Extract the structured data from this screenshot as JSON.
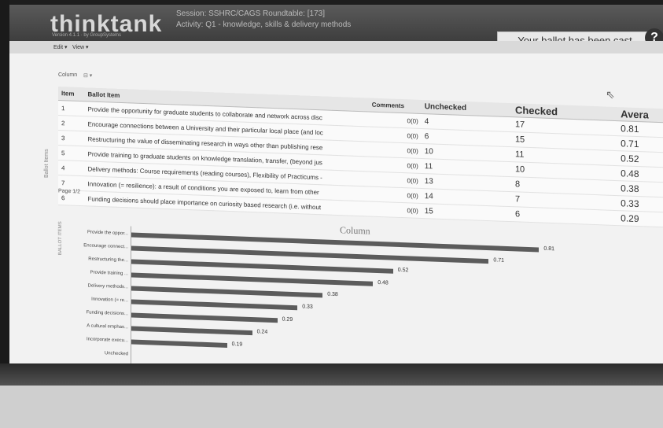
{
  "app": {
    "logo": "thinktank",
    "logo_sub": "Version 4.1.1 · by GroupSystems",
    "session": "Session: SSHRC/CAGS Roundtable: [173]",
    "activity": "Activity: Q1 - knowledge, skills & delivery methods",
    "ballot_status": "Your ballot has been cast",
    "help_icon": "?"
  },
  "menubar": {
    "edit": "Edit ▾",
    "view": "View ▾"
  },
  "column_selector": {
    "label": "Column",
    "icon": "⊟ ▾"
  },
  "side_tab": "Ballot Items",
  "table": {
    "headers": {
      "item": "Item",
      "ballot": "Ballot Item",
      "comments": "Comments",
      "unchecked": "Unchecked",
      "checked": "Checked",
      "average": "Avera"
    },
    "rows": [
      {
        "item": "1",
        "ballot": "Provide the opportunity for graduate students to collaborate and network across disc",
        "comments": "0(0)",
        "unchecked": "4",
        "checked": "17",
        "average": "0.81"
      },
      {
        "item": "2",
        "ballot": "Encourage connections between a University and their particular local place (and loc",
        "comments": "0(0)",
        "unchecked": "6",
        "checked": "15",
        "average": "0.71"
      },
      {
        "item": "3",
        "ballot": "Restructuring the value of disseminating research in ways other than publishing rese",
        "comments": "0(0)",
        "unchecked": "10",
        "checked": "11",
        "average": "0.52"
      },
      {
        "item": "5",
        "ballot": "Provide training to graduate students on knowledge translation, transfer, (beyond jus",
        "comments": "0(0)",
        "unchecked": "11",
        "checked": "10",
        "average": "0.48"
      },
      {
        "item": "4",
        "ballot": "Delivery methods: Course requirements (reading courses), Flexibility of Practicums -",
        "comments": "0(0)",
        "unchecked": "13",
        "checked": "8",
        "average": "0.38"
      },
      {
        "item": "7",
        "ballot": "Innovation (= resilience): a result of conditions you are exposed to, learn from other",
        "comments": "0(0)",
        "unchecked": "14",
        "checked": "7",
        "average": "0.33"
      },
      {
        "item": "6",
        "ballot": "Funding decisions should place importance on curiosity based research (i.e. without",
        "comments": "0(0)",
        "unchecked": "15",
        "checked": "6",
        "average": "0.29"
      }
    ]
  },
  "pager": "Page 1/2",
  "chart_data": {
    "type": "bar",
    "title": "Column",
    "ylabel": "BALLOT ITEMS",
    "categories": [
      "Provide the oppor...",
      "Encourage connect...",
      "Restructuring the...",
      "Provide training ...",
      "Delivery methods...",
      "Innovation (= re...",
      "Funding decisions...",
      "A cultural emphas...",
      "Incorporate execu...",
      "Unchecked"
    ],
    "values": [
      0.81,
      0.71,
      0.52,
      0.48,
      0.38,
      0.33,
      0.29,
      0.24,
      0.19,
      null
    ],
    "value_labels": [
      "0.81",
      "0.71",
      "0.52",
      "0.48",
      "0.38",
      "0.33",
      "0.29",
      "0.24",
      "0.19",
      ""
    ],
    "xlim": [
      0,
      1
    ],
    "bar_color": "#5c5c5c"
  },
  "colors": {
    "header": "#4a4a4a",
    "bar": "#5c5c5c"
  }
}
